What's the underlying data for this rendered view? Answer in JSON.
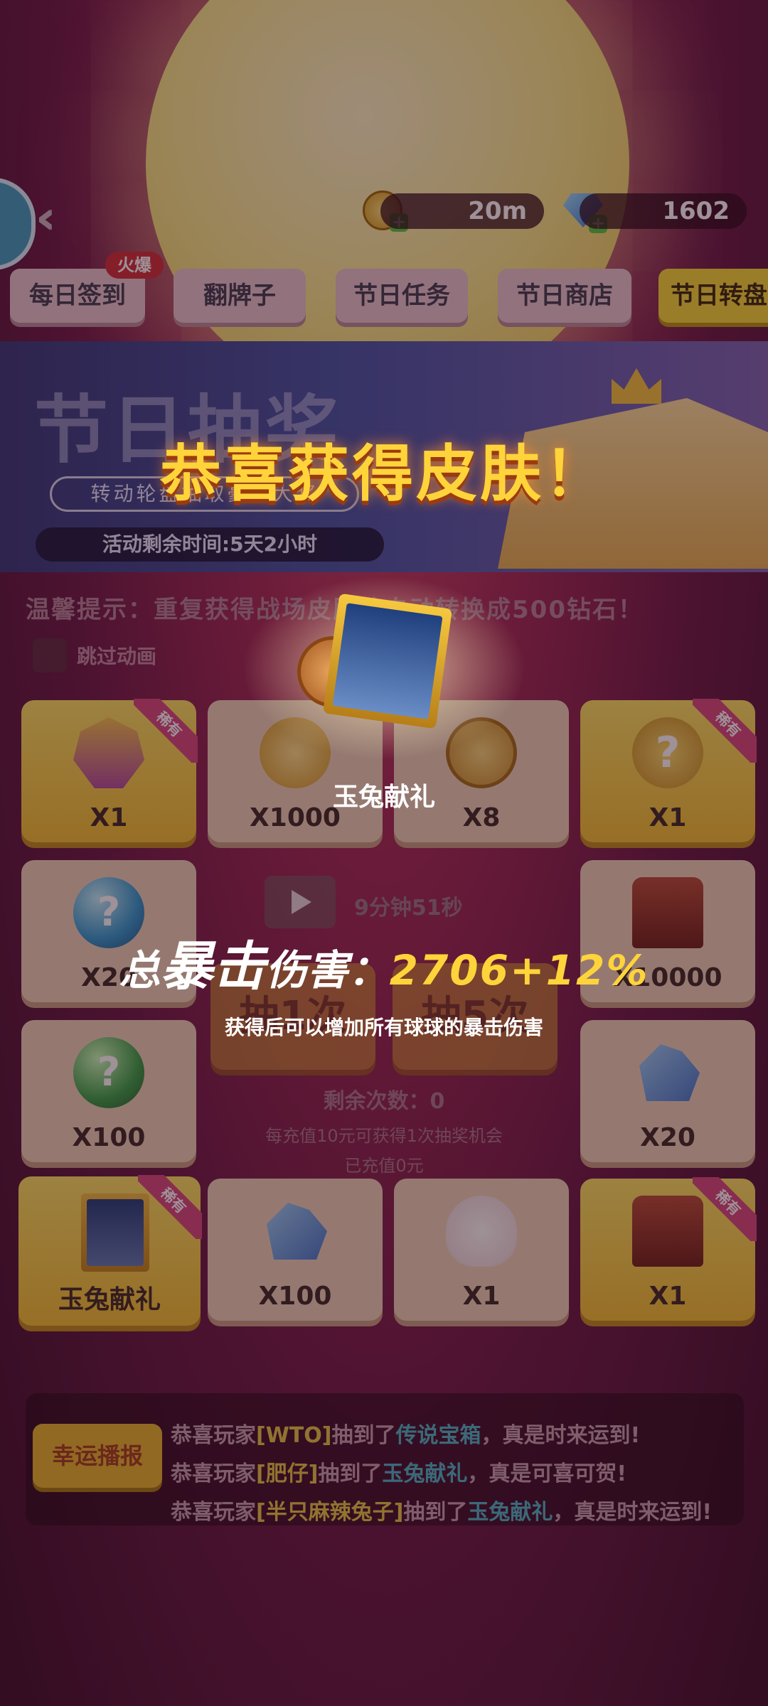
{
  "resources": {
    "coin": "20m",
    "gem": "1602"
  },
  "tabs": [
    {
      "label": "每日签到",
      "badge": "火爆"
    },
    {
      "label": "翻牌子"
    },
    {
      "label": "节日任务"
    },
    {
      "label": "节日商店"
    },
    {
      "label": "节日转盘"
    }
  ],
  "banner": {
    "title": "节日抽奖",
    "subtitle": "转动轮盘抽取豪华大奖",
    "time_left": "活动剩余时间:5天2小时"
  },
  "hint": "温馨提示：重复获得战场皮肤将自动转换成500钻石！",
  "skip_animation": "跳过动画",
  "grid": {
    "ribbon": "稀有",
    "cells": [
      {
        "qty": "X1",
        "icon": "armor-skin-icon"
      },
      {
        "qty": "X1000",
        "icon": "gold-coins-icon"
      },
      {
        "qty": "X8",
        "icon": "big-coin-icon"
      },
      {
        "qty": "X1",
        "icon": "mystery-gold-icon"
      },
      {
        "qty": "X20",
        "icon": "blue-orb-icon"
      },
      {
        "qty": "X10000",
        "icon": "coin-chest-icon"
      },
      {
        "qty": "X100",
        "icon": "green-orb-icon"
      },
      {
        "qty": "X20",
        "icon": "blue-gems-icon"
      },
      {
        "qty": "玉兔献礼",
        "icon": "rabbit-portrait-icon"
      },
      {
        "qty": "X100",
        "icon": "blue-gems-icon"
      },
      {
        "qty": "X1",
        "icon": "white-rabbit-icon"
      },
      {
        "qty": "X1",
        "icon": "treasure-chest-icon"
      }
    ]
  },
  "center": {
    "timer": "9分钟51秒",
    "draw_once": "抽1次",
    "draw_five": "抽5次",
    "remaining": "剩余次数：0",
    "recharge_hint": "每充值10元可获得1次抽奖机会",
    "recharged": "已充值0元"
  },
  "reward_popup": {
    "title": "恭喜获得皮肤！",
    "prize_name": "玉兔献礼",
    "crit_prefix": "总",
    "crit_big": "暴击",
    "crit_suffix": "伤害：",
    "crit_value": "2706+12%",
    "description": "获得后可以增加所有球球的暴击伤害"
  },
  "broadcast": {
    "button": "幸运播报",
    "lines": [
      {
        "pre": "恭喜玩家",
        "player": "[WTO]",
        "mid": "抽到了",
        "item": "传说宝箱",
        "post": "，真是时来运到!"
      },
      {
        "pre": "恭喜玩家",
        "player": "[肥仔]",
        "mid": "抽到了",
        "item": "玉兔献礼",
        "post": "，真是可喜可贺!"
      },
      {
        "pre": "恭喜玩家",
        "player": "[半只麻辣兔子]",
        "mid": "抽到了",
        "item": "玉兔献礼",
        "post": "，真是时来运到!"
      }
    ]
  },
  "colors": {
    "accent": "#f8da35",
    "crit": "#ffd43a",
    "item_link": "#4db7c9",
    "player": "#e8c945"
  }
}
